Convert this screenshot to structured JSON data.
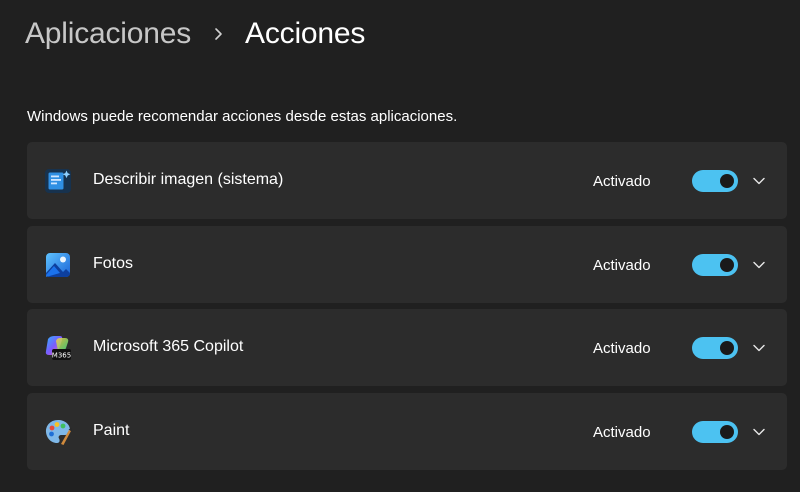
{
  "breadcrumb": {
    "parent": "Aplicaciones",
    "current": "Acciones"
  },
  "description": "Windows puede recomendar acciones desde estas aplicaciones.",
  "accent_color": "#4cc2f1",
  "apps": [
    {
      "name": "Describir imagen (sistema)",
      "state": "Activado",
      "on": true,
      "icon": "describe-image-icon"
    },
    {
      "name": "Fotos",
      "state": "Activado",
      "on": true,
      "icon": "photos-icon"
    },
    {
      "name": "Microsoft 365 Copilot",
      "state": "Activado",
      "on": true,
      "icon": "copilot-icon",
      "icon_text": "M365"
    },
    {
      "name": "Paint",
      "state": "Activado",
      "on": true,
      "icon": "paint-icon"
    }
  ]
}
